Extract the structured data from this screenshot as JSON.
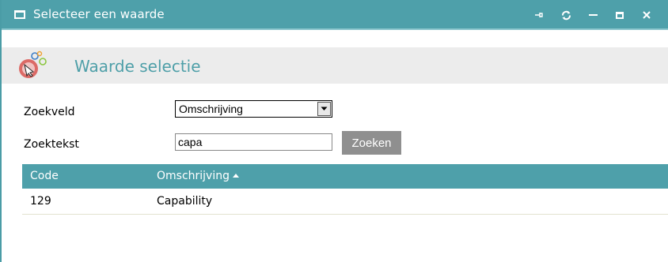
{
  "window": {
    "title": "Selecteer een waarde"
  },
  "controls": {
    "pin": "pin-icon",
    "refresh": "refresh-icon",
    "minimize": "minimize-icon",
    "maximize": "maximize-icon",
    "close": "close-icon"
  },
  "header": {
    "title": "Waarde selectie"
  },
  "form": {
    "field_label": "Zoekveld",
    "field_value": "Omschrijving",
    "text_label": "Zoektekst",
    "text_value": "capa",
    "search_button": "Zoeken"
  },
  "table": {
    "columns": [
      "Code",
      "Omschrijving"
    ],
    "rows": [
      {
        "code": "129",
        "desc": "Capability"
      }
    ]
  },
  "colors": {
    "accent": "#4ea0aa",
    "header_band": "#ececec",
    "button": "#8f8f8f"
  }
}
